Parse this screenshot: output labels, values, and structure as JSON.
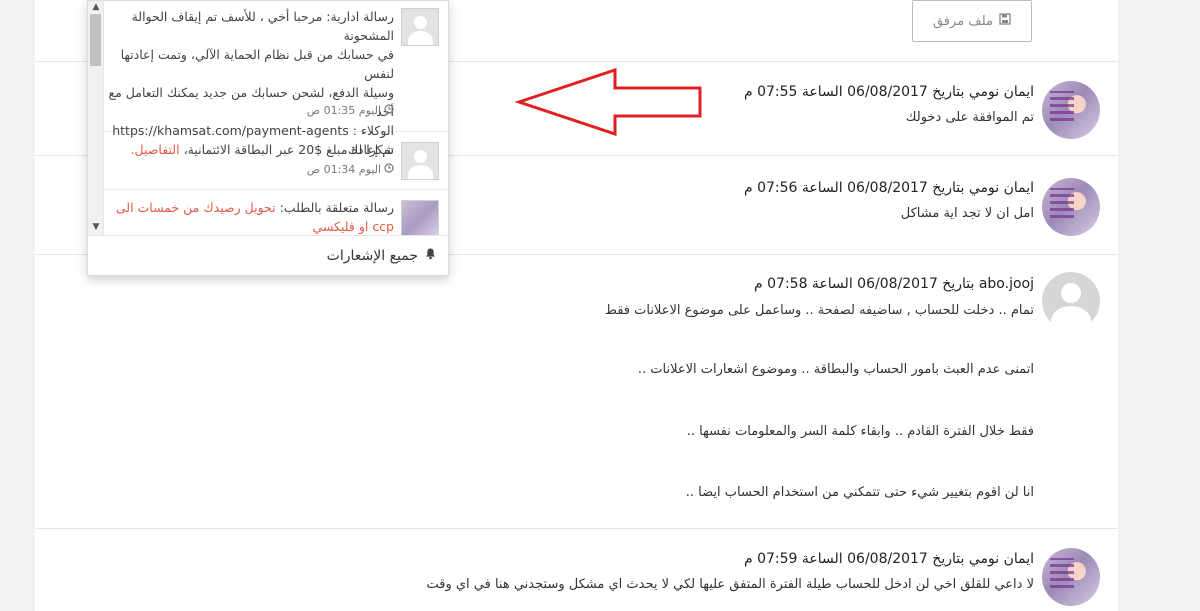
{
  "attachment": {
    "label": "ملف مرفق",
    "icon": "save-icon"
  },
  "messages": [
    {
      "author": "ايمان نومي",
      "header": "ايمان نومي بتاريخ 06/08/2017 الساعة 07:55 م",
      "lines": [
        "تم الموافقة على دخولك"
      ],
      "avatar": "user-avatar"
    },
    {
      "author": "ايمان نومي",
      "header": "ايمان نومي بتاريخ 06/08/2017 الساعة 07:56 م",
      "lines": [
        "امل ان لا تجد اية مشاكل"
      ],
      "avatar": "user-avatar"
    },
    {
      "author": "abo.jooj",
      "header": "abo.jooj بتاريخ 06/08/2017 الساعة 07:58 م",
      "lines": [
        "تمام .. دخلت للحساب , ساضيفه لصفحة .. وساعمل على موضوع الاعلانات فقط",
        "اتمنى عدم العبث بامور الحساب والبطاقة .. وموضوع اشعارات الاعلانات ..",
        "فقط خلال الفترة القادم .. وابقاء كلمة السر والمعلومات نفسها ..",
        "انا لن اقوم بتغيير شيء حتى تتمكني من استخدام الحساب ايضا .."
      ],
      "avatar": "default-avatar"
    },
    {
      "author": "ايمان نومي",
      "header": "ايمان نومي بتاريخ 06/08/2017 الساعة 07:59 م",
      "lines": [
        "لا داعي للقلق اخي لن ادخل للحساب طيلة الفترة المتفق عليها لكي لا يحدث اي مشكل وستجدني هنا في اي وقت"
      ],
      "avatar": "user-avatar"
    }
  ],
  "notifications": {
    "items": [
      {
        "lines": [
          "رسالة ادارية: مرحبا أخي ، للأسف تم إيقاف الحوالة المشحونة",
          "في حسابك من قبل نظام الحماية الآلي، وتمت إعادتها لنفس",
          "وسيلة الدفع، لشحن حسابك من جديد يمكنك التعامل مع أحد",
          "الوكلاء : https://khamsat.com/payment-agents",
          "شكرا لك"
        ],
        "time": "اليوم 01:35 ص"
      },
      {
        "text": "تم إعادة مبلغ $20 عبر البطاقة الائتمانية،",
        "link": "التفاصيل.",
        "time": "اليوم 01:34 ص"
      },
      {
        "text": "رسالة متعلقة بالطلب:",
        "link": "تحويل رصيدك من خمسات الى ccp او فليكسي"
      }
    ],
    "footer_label": "جميع الإشعارات"
  },
  "colors": {
    "link": "#e25b45",
    "arrow": "#e02020",
    "page_bg": "#f2f2f2"
  }
}
